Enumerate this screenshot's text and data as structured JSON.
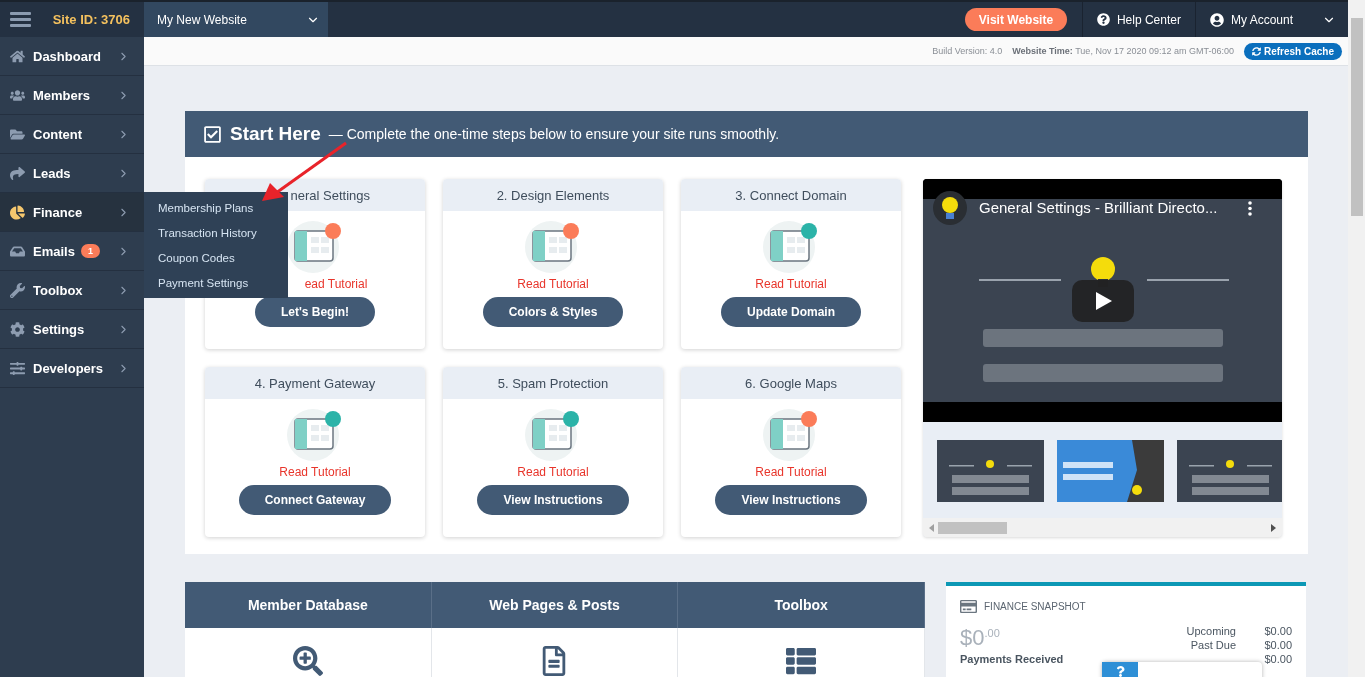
{
  "topbar": {
    "site_id": "Site ID: 3706",
    "website_select": "My New Website",
    "visit_button": "Visit Website",
    "help": "Help Center",
    "account": "My Account"
  },
  "infobar": {
    "build": "Build Version: 4.0",
    "time_label": "Website Time:",
    "time_value": "Tue, Nov 17 2020 09:12 am GMT-06:00",
    "refresh": "Refresh Cache"
  },
  "sidebar": {
    "items": [
      {
        "label": "Dashboard",
        "selected": false
      },
      {
        "label": "Members",
        "selected": false
      },
      {
        "label": "Content",
        "selected": false
      },
      {
        "label": "Leads",
        "selected": false
      },
      {
        "label": "Finance",
        "selected": true
      },
      {
        "label": "Emails",
        "selected": false,
        "badge": "1"
      },
      {
        "label": "Toolbox",
        "selected": false
      },
      {
        "label": "Settings",
        "selected": false
      },
      {
        "label": "Developers",
        "selected": false
      }
    ]
  },
  "submenu": {
    "items": [
      "Membership Plans",
      "Transaction History",
      "Coupon Codes",
      "Payment Settings"
    ]
  },
  "start_here": {
    "title": "Start Here",
    "subtitle": "— Complete the one-time steps below to ensure your site runs smoothly.",
    "steps": [
      {
        "title": "neral Settings",
        "link": "ead Tutorial",
        "button": "Let's Begin!",
        "covered": true
      },
      {
        "title": "2. Design Elements",
        "link": "Read Tutorial",
        "button": "Colors & Styles",
        "covered": false
      },
      {
        "title": "3. Connect Domain",
        "link": "Read Tutorial",
        "button": "Update Domain",
        "covered": false
      },
      {
        "title": "4. Payment Gateway",
        "link": "Read Tutorial",
        "button": "Connect Gateway",
        "covered": false
      },
      {
        "title": "5. Spam Protection",
        "link": "Read Tutorial",
        "button": "View Instructions",
        "covered": false
      },
      {
        "title": "6. Google Maps",
        "link": "Read Tutorial",
        "button": "View Instructions",
        "covered": false
      }
    ],
    "video": {
      "title": "General Settings - Brilliant Directo..."
    }
  },
  "shortcuts": [
    {
      "label": "Member Database"
    },
    {
      "label": "Web Pages & Posts"
    },
    {
      "label": "Toolbox"
    }
  ],
  "finance": {
    "title": "FINANCE SNAPSHOT",
    "amount": "$0",
    "cents": ".00",
    "received": "Payments Received",
    "rows": [
      {
        "label": "Upcoming",
        "value": "$0.00"
      },
      {
        "label": "Past Due",
        "value": "$0.00"
      },
      {
        "value": "$0.00"
      }
    ]
  }
}
